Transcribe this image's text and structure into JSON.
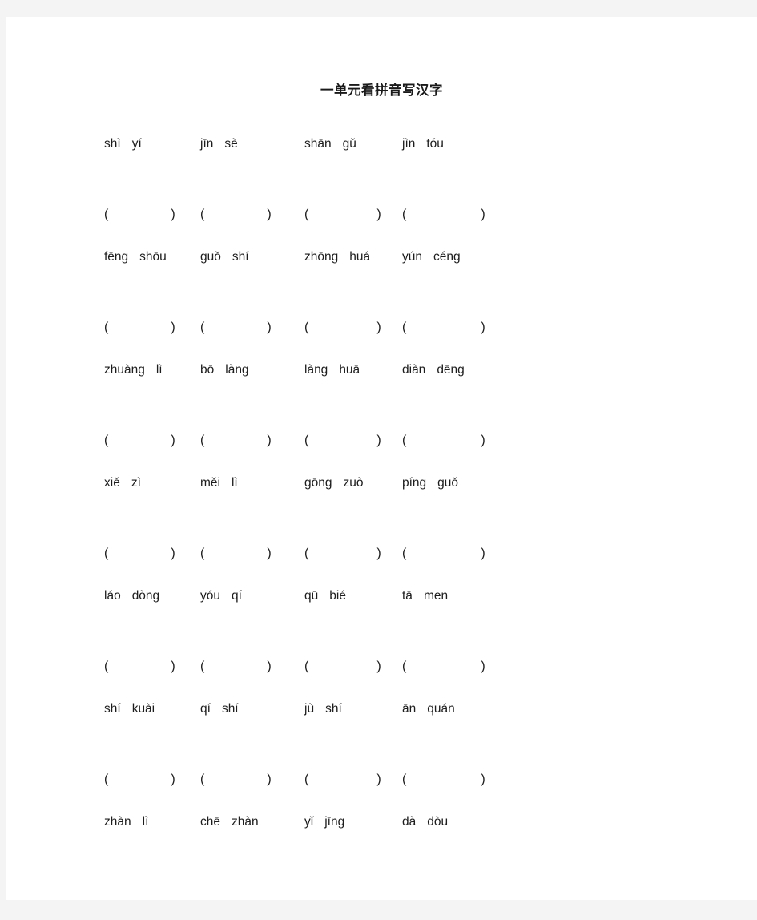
{
  "document": {
    "title": "一单元看拼音写汉字",
    "background_color": "#f4f4f4",
    "page_color": "#ffffff",
    "text_color": "#1d1d1d"
  },
  "answer_slot": {
    "open": "(",
    "close": ")"
  },
  "exercises": [
    {
      "words": [
        {
          "syllables": [
            "shì",
            "yí"
          ]
        },
        {
          "syllables": [
            "jīn",
            "sè"
          ]
        },
        {
          "syllables": [
            "shān",
            "gǔ"
          ]
        },
        {
          "syllables": [
            "jìn",
            "tóu"
          ]
        }
      ]
    },
    {
      "words": [
        {
          "syllables": [
            "fēng",
            "shōu"
          ]
        },
        {
          "syllables": [
            "guǒ",
            "shí"
          ]
        },
        {
          "syllables": [
            "zhōng",
            "huá"
          ]
        },
        {
          "syllables": [
            "yún",
            "céng"
          ]
        }
      ]
    },
    {
      "words": [
        {
          "syllables": [
            "zhuàng",
            "lì"
          ]
        },
        {
          "syllables": [
            "bō",
            "làng"
          ]
        },
        {
          "syllables": [
            "làng",
            "huā"
          ]
        },
        {
          "syllables": [
            "diàn",
            "dēng"
          ]
        }
      ]
    },
    {
      "words": [
        {
          "syllables": [
            "xiě",
            "zì"
          ]
        },
        {
          "syllables": [
            "měi",
            "lì"
          ]
        },
        {
          "syllables": [
            "gōng",
            "zuò"
          ]
        },
        {
          "syllables": [
            "píng",
            "guǒ"
          ]
        }
      ]
    },
    {
      "words": [
        {
          "syllables": [
            "láo",
            "dòng"
          ]
        },
        {
          "syllables": [
            "yóu",
            "qí"
          ]
        },
        {
          "syllables": [
            "qū",
            "bié"
          ]
        },
        {
          "syllables": [
            "tā",
            "men"
          ]
        }
      ]
    },
    {
      "words": [
        {
          "syllables": [
            "shí",
            "kuài"
          ]
        },
        {
          "syllables": [
            "qí",
            "shí"
          ]
        },
        {
          "syllables": [
            "jù",
            "shí"
          ]
        },
        {
          "syllables": [
            "ān",
            "quán"
          ]
        }
      ]
    },
    {
      "words": [
        {
          "syllables": [
            "zhàn",
            "lì"
          ]
        },
        {
          "syllables": [
            "chē",
            "zhàn"
          ]
        },
        {
          "syllables": [
            "yǐ",
            "jīng"
          ]
        },
        {
          "syllables": [
            "dà",
            "dòu"
          ]
        }
      ],
      "has_answer_row": false
    }
  ]
}
